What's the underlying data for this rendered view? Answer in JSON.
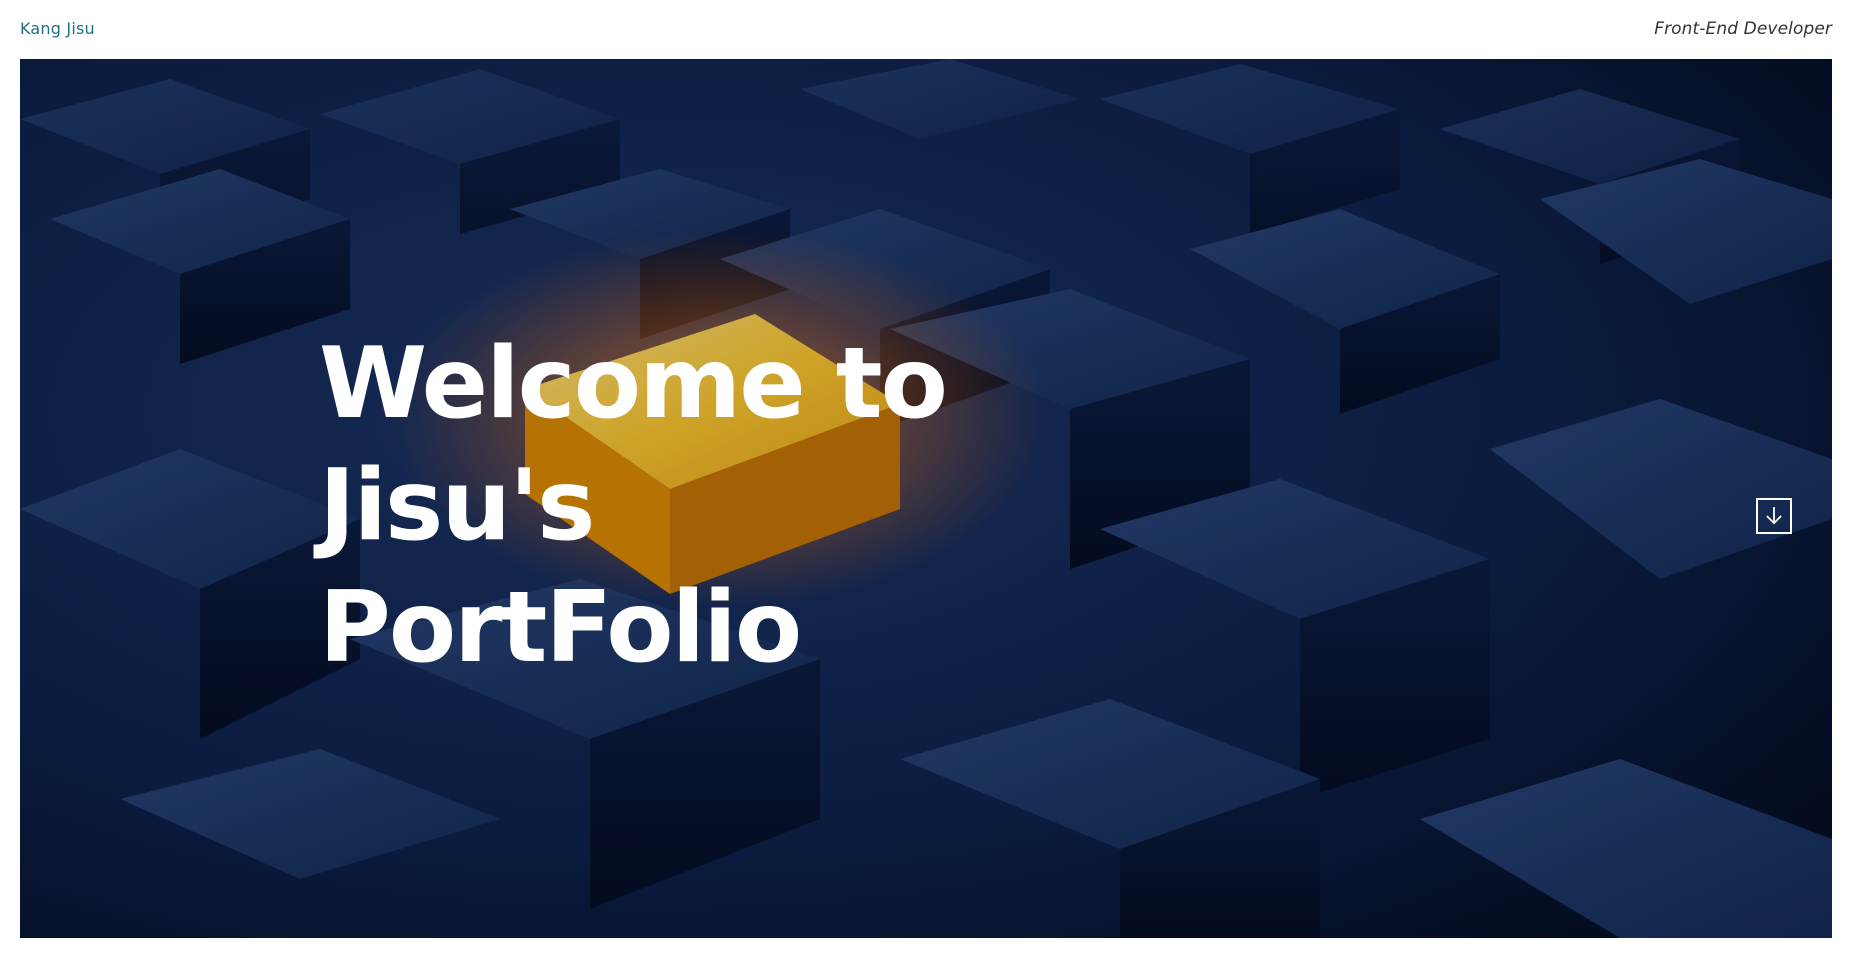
{
  "header": {
    "brand": "Kang Jisu",
    "role": "Front-End Developer"
  },
  "hero": {
    "headline_lines": [
      "Welcome to",
      "Jisu's",
      "PortFolio"
    ],
    "background_image": "dark-blue-cubes-with-glowing-orange-cube",
    "scroll_icon": "arrow-down-icon"
  },
  "colors": {
    "brand": "#1f6f86",
    "hero_background": "#0b1a3a",
    "highlight_cube": "#f5b700",
    "headline": "#ffffff"
  }
}
